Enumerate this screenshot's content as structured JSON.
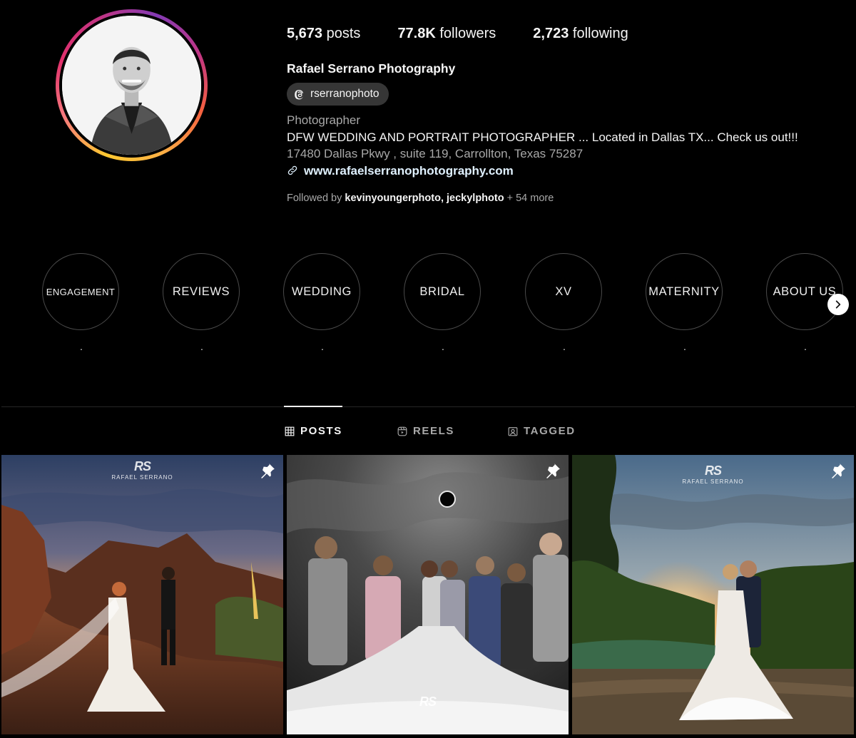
{
  "profile": {
    "stats": [
      {
        "count": "5,673",
        "label": "posts"
      },
      {
        "count": "77.8K",
        "label": "followers"
      },
      {
        "count": "2,723",
        "label": "following"
      }
    ],
    "name": "Rafael Serrano Photography",
    "threads_handle": "rserranophoto",
    "category": "Photographer",
    "bio_line": "DFW WEDDING AND PORTRAIT PHOTOGRAPHER ... Located in Dallas TX... Check us out!!!",
    "address": "17480 Dallas Pkwy , suite 119, Carrollton, Texas 75287",
    "website": "www.rafaelserranophotography.com",
    "followed_by_prefix": "Followed by",
    "followed_by_users": "kevinyoungerphoto, jeckylphoto",
    "followed_by_more": "+ 54 more"
  },
  "highlights": [
    {
      "label": "ENGAGEMENT",
      "caption": "."
    },
    {
      "label": "REVIEWS",
      "caption": "."
    },
    {
      "label": "WEDDING",
      "caption": "."
    },
    {
      "label": "BRIDAL",
      "caption": "."
    },
    {
      "label": "XV",
      "caption": "."
    },
    {
      "label": "MATERNITY",
      "caption": "."
    },
    {
      "label": "ABOUT US",
      "caption": "."
    }
  ],
  "tabs": [
    {
      "label": "POSTS",
      "icon": "grid-icon",
      "active": true
    },
    {
      "label": "REELS",
      "icon": "reels-icon",
      "active": false
    },
    {
      "label": "TAGGED",
      "icon": "tagged-icon",
      "active": false
    }
  ],
  "posts": [
    {
      "pinned": true,
      "watermark_mono": "RS",
      "watermark_text": "RAFAEL SERRANO"
    },
    {
      "pinned": true,
      "watermark_mono": "RS"
    },
    {
      "pinned": true,
      "watermark_mono": "RS",
      "watermark_text": "RAFAEL SERRANO"
    }
  ],
  "colors": {
    "background": "#000000",
    "text_primary": "#f5f5f5",
    "text_secondary": "#a8a8a8",
    "link": "#e0f1ff",
    "chip_bg": "#363636"
  }
}
